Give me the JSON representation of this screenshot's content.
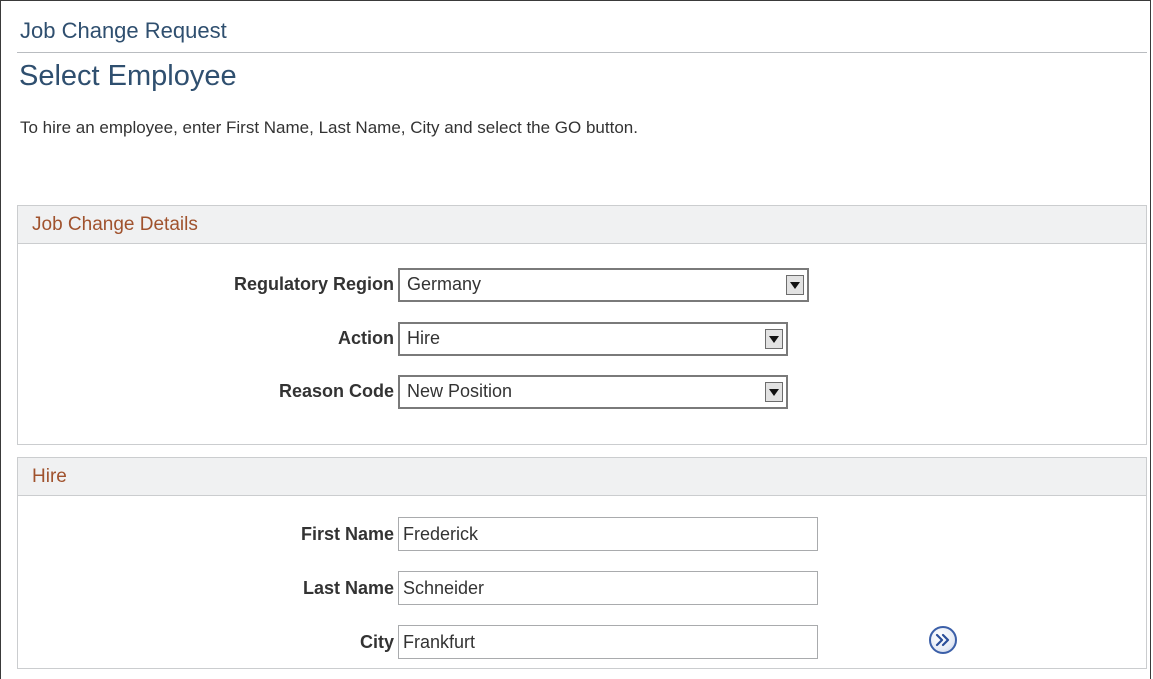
{
  "header": {
    "breadcrumb": "Job Change Request",
    "page_title": "Select Employee",
    "instructions": "To hire an employee, enter First Name, Last Name, City and select the GO button."
  },
  "job_change_details": {
    "title": "Job Change Details",
    "regulatory_region": {
      "label": "Regulatory Region",
      "value": "Germany"
    },
    "action": {
      "label": "Action",
      "value": "Hire"
    },
    "reason_code": {
      "label": "Reason Code",
      "value": "New Position"
    }
  },
  "hire": {
    "title": "Hire",
    "first_name": {
      "label": "First Name",
      "value": "Frederick"
    },
    "last_name": {
      "label": "Last Name",
      "value": "Schneider"
    },
    "city": {
      "label": "City",
      "value": "Frankfurt"
    }
  },
  "icons": {
    "go_button": "double-chevron-right-icon",
    "dropdown": "chevron-down-icon"
  },
  "colors": {
    "title_blue": "#2f4f6f",
    "section_title": "#a0522d",
    "section_header_bg": "#f0f1f2",
    "go_button_border": "#3b5fa8"
  }
}
